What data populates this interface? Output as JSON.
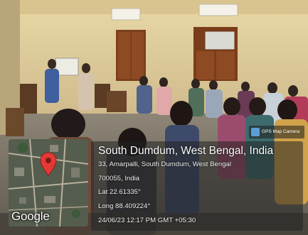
{
  "badge": {
    "label": "GPS Map Camera",
    "icon": "gps-map-camera-icon"
  },
  "map": {
    "google_label": "Google",
    "pin_icon": "location-pin-icon",
    "pin_color": "#e53935"
  },
  "location": {
    "title": "South Dumdum, West Bengal, India",
    "address_line1": "33, Amarpalli, South Dumdum, West Bengal",
    "address_line2": "700055, India",
    "latitude": "Lat 22.61335°",
    "longitude": "Long 88.409224°",
    "timestamp": "24/06/23 12:17 PM GMT +05:30"
  }
}
